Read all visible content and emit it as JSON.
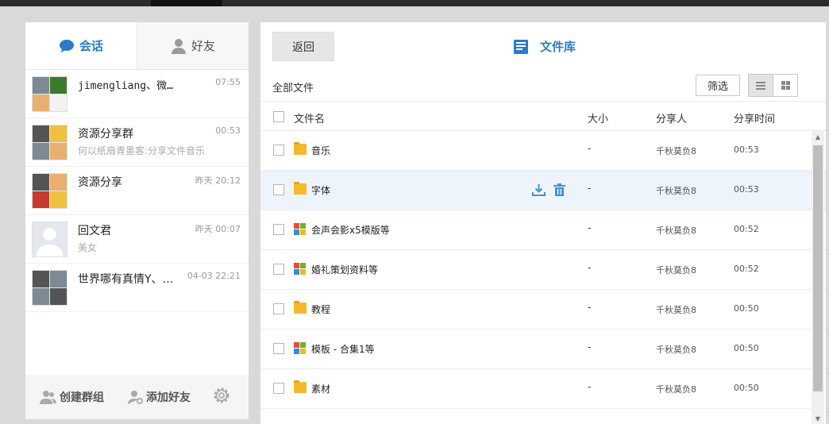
{
  "tabs": {
    "chat": "会话",
    "friends": "好友"
  },
  "conversations": [
    {
      "name": "jimengliang、微…",
      "time": "07:55",
      "sub": ""
    },
    {
      "name": "资源分享群",
      "time": "00:53",
      "sub": "何以纸扇青墨客:分享文件音乐"
    },
    {
      "name": "资源分享",
      "time": "昨天 20:12",
      "sub": ""
    },
    {
      "name": "回文君",
      "time": "昨天 00:07",
      "sub": "美女"
    },
    {
      "name": "世界哪有真情Y、…",
      "time": "04-03 22:21",
      "sub": ""
    }
  ],
  "footer": {
    "create_group": "创建群组",
    "add_friend": "添加好友"
  },
  "header": {
    "back": "返回",
    "title": "文件库"
  },
  "toolbar": {
    "breadcrumb": "全部文件",
    "filter": "筛选"
  },
  "columns": {
    "name": "文件名",
    "size": "大小",
    "sharer": "分享人",
    "time": "分享时间"
  },
  "files": [
    {
      "name": "音乐",
      "icon": "folder-icon",
      "size": "-",
      "sharer": "千秋莫负8",
      "time": "00:53"
    },
    {
      "name": "字体",
      "icon": "folder-icon",
      "size": "-",
      "sharer": "千秋莫负8",
      "time": "00:53"
    },
    {
      "name": "会声会影x5模版等",
      "icon": "windows-icon",
      "size": "-",
      "sharer": "千秋莫负8",
      "time": "00:52"
    },
    {
      "name": "婚礼策划资料等",
      "icon": "windows-icon",
      "size": "-",
      "sharer": "千秋莫负8",
      "time": "00:52"
    },
    {
      "name": "教程",
      "icon": "folder-icon",
      "size": "-",
      "sharer": "千秋莫负8",
      "time": "00:50"
    },
    {
      "name": "模板 - 合集1等",
      "icon": "windows-icon",
      "size": "-",
      "sharer": "千秋莫负8",
      "time": "00:50"
    },
    {
      "name": "素材",
      "icon": "folder-icon",
      "size": "-",
      "sharer": "千秋莫负8",
      "time": "00:50"
    }
  ],
  "colors": {
    "accent": "#2a7cc7",
    "hover_row": "#edf4fb"
  }
}
